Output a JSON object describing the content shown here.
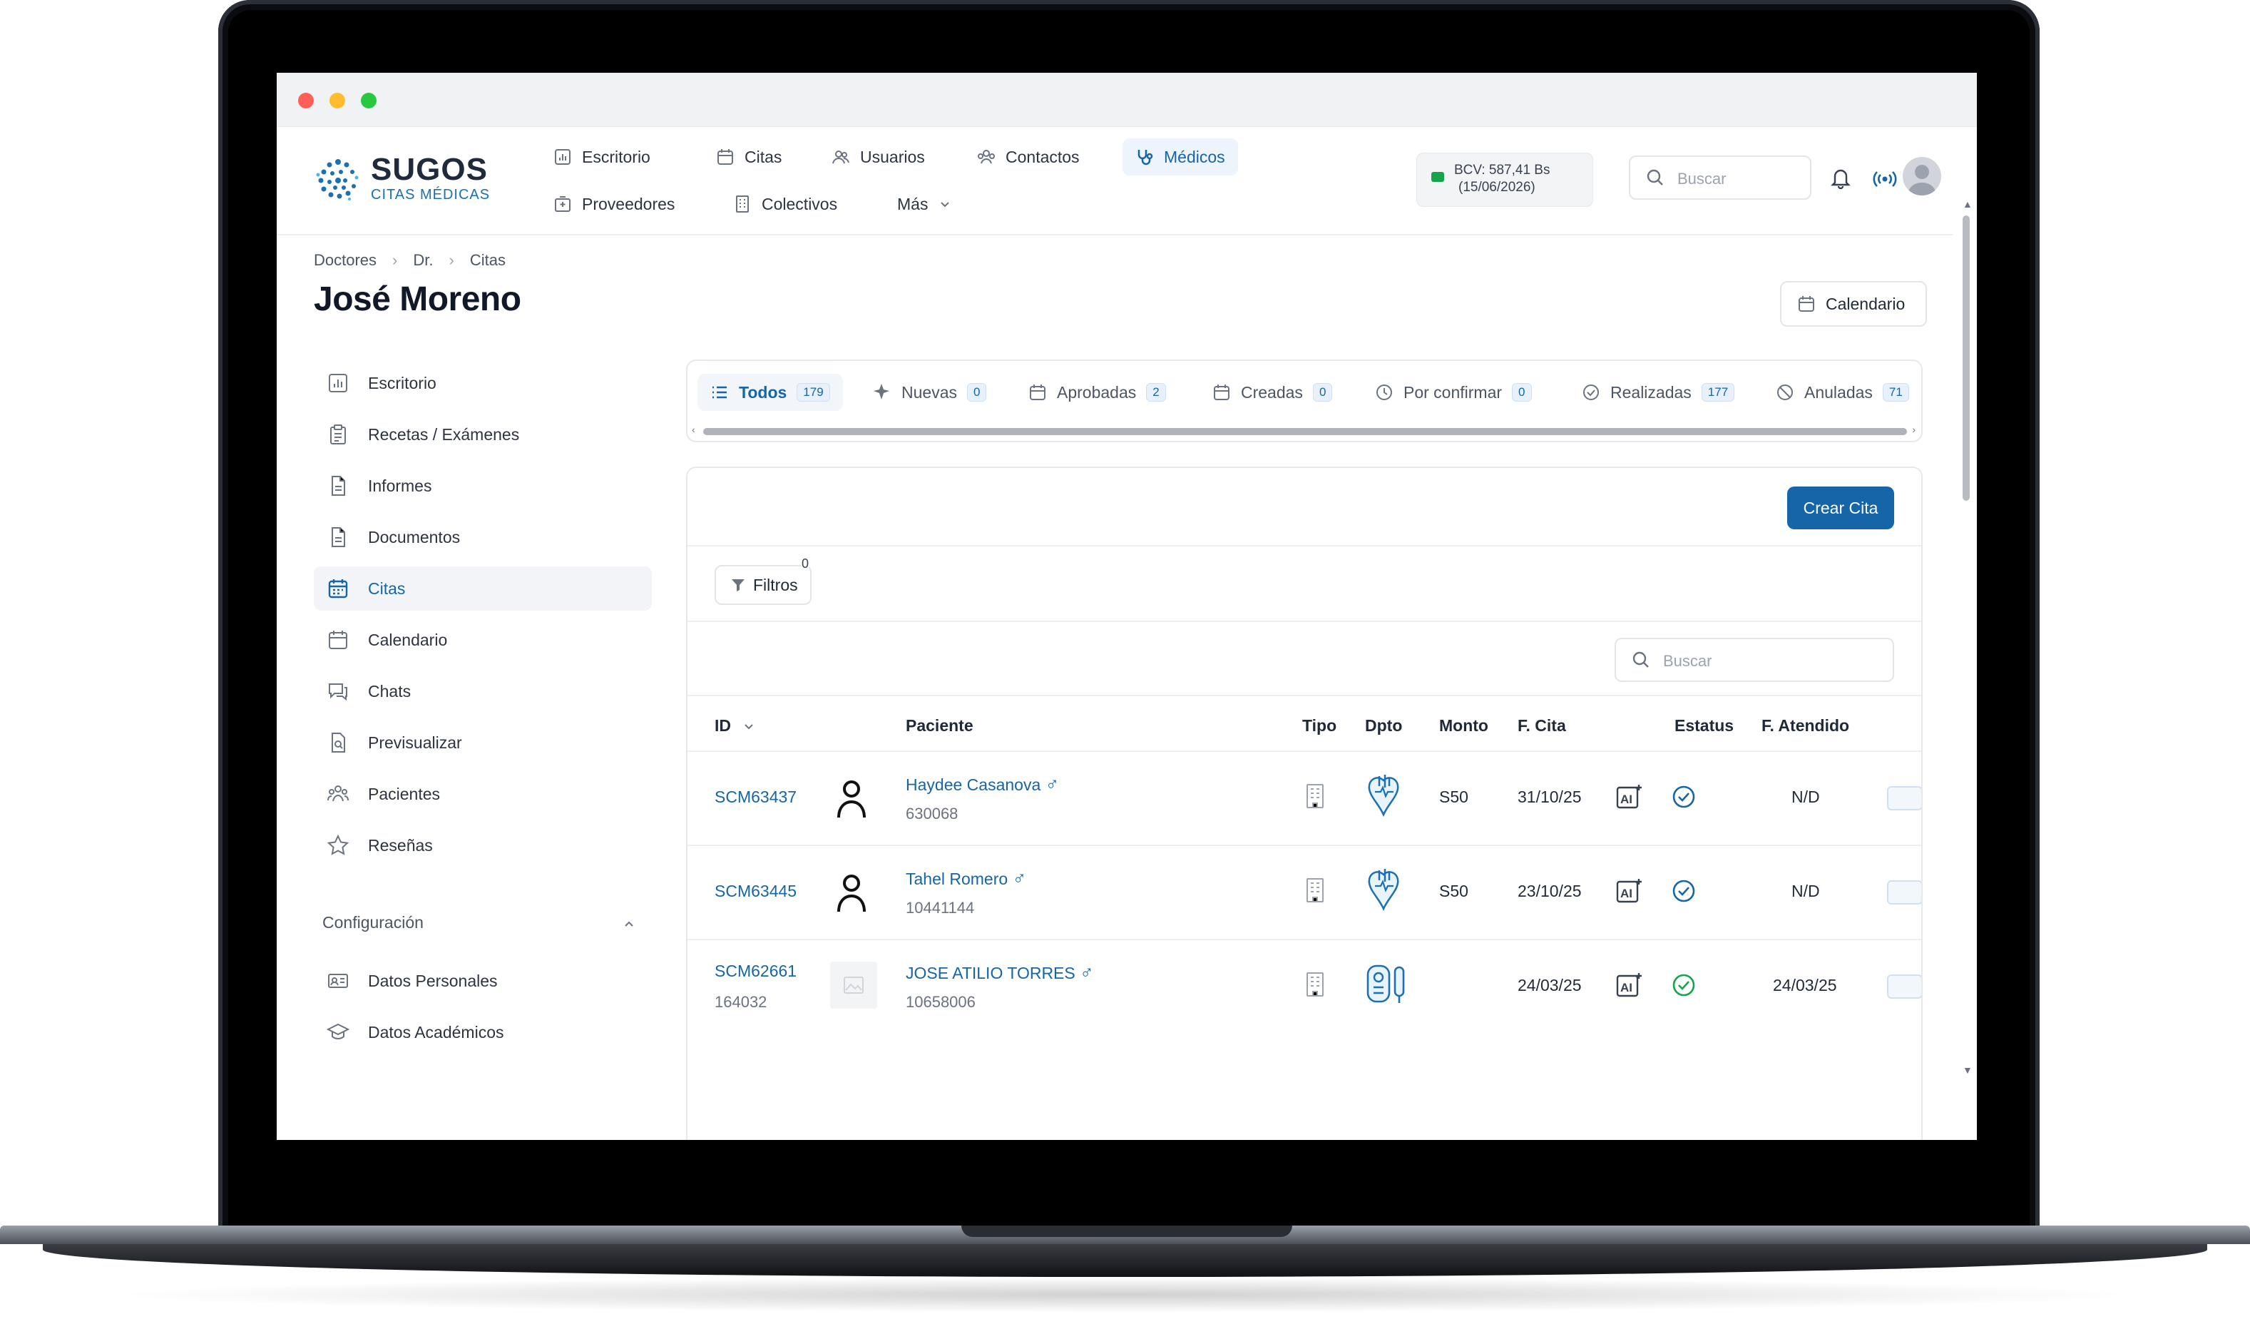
{
  "app": {
    "logo_title": "SUGOS",
    "logo_subtitle": "CITAS MÉDICAS"
  },
  "nav": {
    "row1": [
      {
        "label": "Escritorio",
        "icon": "chart-icon"
      },
      {
        "label": "Citas",
        "icon": "calendar-icon"
      },
      {
        "label": "Usuarios",
        "icon": "users-icon"
      },
      {
        "label": "Contactos",
        "icon": "contacts-icon"
      },
      {
        "label": "Médicos",
        "icon": "stethoscope-icon",
        "active": true
      }
    ],
    "row2": [
      {
        "label": "Proveedores",
        "icon": "hospital-icon"
      },
      {
        "label": "Colectivos",
        "icon": "building-icon"
      },
      {
        "label": "Más",
        "icon": "chevron-down-icon"
      }
    ]
  },
  "header": {
    "bcv_line1": "BCV: 587,41 Bs",
    "bcv_line2": "(15/06/2026)",
    "search_placeholder": "Buscar"
  },
  "breadcrumb": [
    "Doctores",
    "Dr.",
    "Citas"
  ],
  "page_title": "José Moreno",
  "calendar_button": "Calendario",
  "sidebar": {
    "items": [
      {
        "label": "Escritorio",
        "icon": "chart-icon"
      },
      {
        "label": "Recetas / Exámenes",
        "icon": "clipboard-icon"
      },
      {
        "label": "Informes",
        "icon": "document-icon"
      },
      {
        "label": "Documentos",
        "icon": "document-icon"
      },
      {
        "label": "Citas",
        "icon": "calendar-icon",
        "active": true
      },
      {
        "label": "Calendario",
        "icon": "calendar-icon"
      },
      {
        "label": "Chats",
        "icon": "chat-icon"
      },
      {
        "label": "Previsualizar",
        "icon": "preview-icon"
      },
      {
        "label": "Pacientes",
        "icon": "users-icon"
      },
      {
        "label": "Reseñas",
        "icon": "star-icon"
      }
    ],
    "config_title": "Configuración",
    "config_items": [
      {
        "label": "Datos Personales",
        "icon": "id-card-icon"
      },
      {
        "label": "Datos Académicos",
        "icon": "graduation-cap-icon"
      }
    ]
  },
  "tabs": [
    {
      "label": "Todos",
      "count": "179",
      "icon": "list-icon",
      "active": true
    },
    {
      "label": "Nuevas",
      "count": "0",
      "icon": "sparkle-icon"
    },
    {
      "label": "Aprobadas",
      "count": "2",
      "icon": "calendar-icon"
    },
    {
      "label": "Creadas",
      "count": "0",
      "icon": "calendar-icon"
    },
    {
      "label": "Por confirmar",
      "count": "0",
      "icon": "clock-icon"
    },
    {
      "label": "Realizadas",
      "count": "177",
      "icon": "check-circle-icon"
    },
    {
      "label": "Anuladas",
      "count": "71",
      "icon": "ban-icon"
    }
  ],
  "toolbar": {
    "create_button": "Crear Cita",
    "filters_label": "Filtros",
    "filters_count": "0",
    "search_placeholder": "Buscar"
  },
  "table": {
    "headers": {
      "id": "ID",
      "patient": "Paciente",
      "type": "Tipo",
      "dept": "Dpto",
      "amount": "Monto",
      "date": "F. Cita",
      "status": "Estatus",
      "attended": "F. Atendido"
    },
    "rows": [
      {
        "id": "SCM63437",
        "id_sub": "",
        "patient": "Haydee Casanova",
        "patient_id": "630068",
        "amount": "S50",
        "date": "31/10/25",
        "attended": "N/D",
        "status_color": "#1565a8",
        "dept_icon": "cardiology-icon"
      },
      {
        "id": "SCM63445",
        "id_sub": "",
        "patient": "Tahel Romero",
        "patient_id": "10441144",
        "amount": "S50",
        "date": "23/10/25",
        "attended": "N/D",
        "status_color": "#1565a8",
        "dept_icon": "cardiology-icon"
      },
      {
        "id": "SCM62661",
        "id_sub": "164032",
        "patient": "JOSE ATILIO TORRES",
        "patient_id": "10658006",
        "amount": "",
        "date": "24/03/25",
        "attended": "24/03/25",
        "status_color": "#16a34a",
        "dept_icon": "lab-test-icon"
      }
    ]
  },
  "colors": {
    "accent": "#1565a8",
    "success": "#16a34a"
  }
}
